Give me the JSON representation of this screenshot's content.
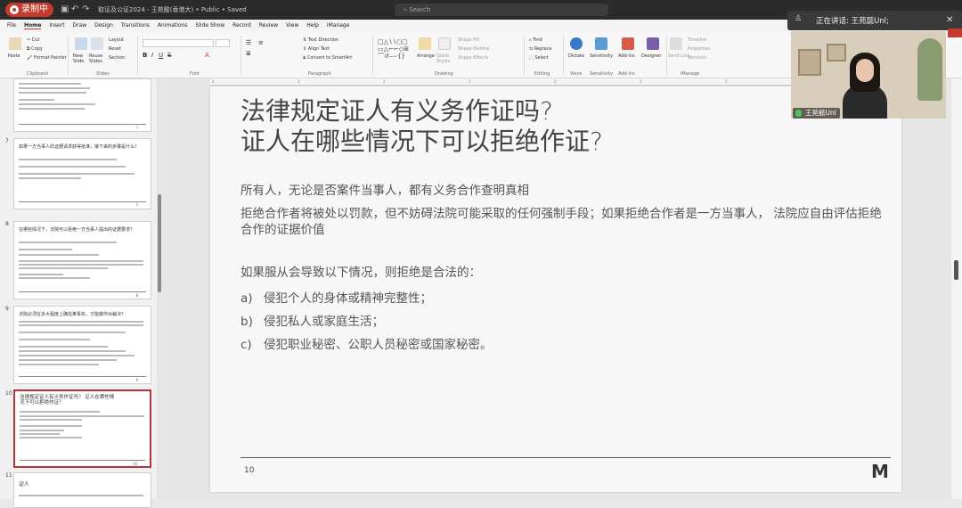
{
  "recorder": {
    "label": "录制中"
  },
  "window": {
    "doc_title": "取证及公证2024 - 王苑懿(香港大) • Public • Saved",
    "search_placeholder": "Search"
  },
  "menu": [
    "File",
    "Home",
    "Insert",
    "Draw",
    "Design",
    "Transitions",
    "Animations",
    "Slide Show",
    "Record",
    "Review",
    "View",
    "Help",
    "iManage"
  ],
  "menu_active": "Home",
  "ribbon": {
    "clipboard": {
      "paste": "Paste",
      "cut": "Cut",
      "copy": "Copy",
      "format_painter": "Format Painter",
      "group": "Clipboard"
    },
    "slides": {
      "new_slide": "New Slide",
      "reuse": "Reuse Slides",
      "layout": "Layout",
      "reset": "Reset",
      "section": "Section",
      "group": "Slides"
    },
    "font": {
      "group": "Font"
    },
    "paragraph": {
      "text_direction": "Text Direction",
      "align_text": "Align Text",
      "smartart": "Convert to SmartArt",
      "group": "Paragraph"
    },
    "drawing": {
      "arrange": "Arrange",
      "quick_styles": "Quick Styles",
      "shape_fill": "Shape Fill",
      "shape_outline": "Shape Outline",
      "shape_effects": "Shape Effects",
      "group": "Drawing"
    },
    "editing": {
      "find": "Find",
      "replace": "Replace",
      "select": "Select",
      "group": "Editing"
    },
    "voice": {
      "dictate": "Dictate",
      "group": "Voice"
    },
    "sensitivity": {
      "label": "Sensitivity",
      "group": "Sensitivity"
    },
    "addins": {
      "label": "Add-ins",
      "group": "Add-ins"
    },
    "designer": {
      "label": "Designer"
    },
    "imanage": {
      "send_link": "Send Link",
      "timeline": "Timeline",
      "properties": "Properties",
      "versions": "Versions",
      "group": "iManage"
    }
  },
  "thumbnails": [
    {
      "num": "",
      "title": "",
      "page": "7"
    },
    {
      "num": "7",
      "title": "如果一方当事人的证据请求获得批准，接下来的步骤是什么？",
      "page": "7"
    },
    {
      "num": "8",
      "title": "在哪些情况下，法院可以拒绝一方当事人提出的证据要求？",
      "page": "8"
    },
    {
      "num": "9",
      "title": "法院必须在多大程度上确信某事实，才能做作出裁决？",
      "page": "9"
    },
    {
      "num": "10",
      "title": "法律规定证人有义务作证吗？ 证人在哪些情况下可以拒绝作证？",
      "page": "10"
    },
    {
      "num": "11",
      "title": "证人",
      "page": ""
    }
  ],
  "selected_thumbnail": "10",
  "ruler_ticks": [
    "4",
    "3",
    "2",
    "1",
    "0",
    "1",
    "2",
    "3",
    "4"
  ],
  "slide": {
    "title_line1": "法律规定证人有义务作证吗?",
    "title_line2": "证人在哪些情况下可以拒绝作证?",
    "para1": "所有人，无论是否案件当事人，都有义务合作查明真相",
    "para2": "拒绝合作者将被处以罚款，但不妨碍法院可能采取的任何强制手段；如果拒绝合作者是一方当事人， 法院应自由评估拒绝合作的证据价值",
    "para3": "如果服从会导致以下情况，则拒绝是合法的：",
    "items": [
      {
        "label": "a)",
        "text": "侵犯个人的身体或精神完整性；"
      },
      {
        "label": "b)",
        "text": "侵犯私人或家庭生活；"
      },
      {
        "label": "c)",
        "text": "侵犯职业秘密、公职人员秘密或国家秘密。"
      }
    ],
    "number": "10",
    "logo": "M"
  },
  "meeting": {
    "speaking_label": "正在讲话: 王苑懿Unl;",
    "participant_name": "王苑懿Unl"
  }
}
